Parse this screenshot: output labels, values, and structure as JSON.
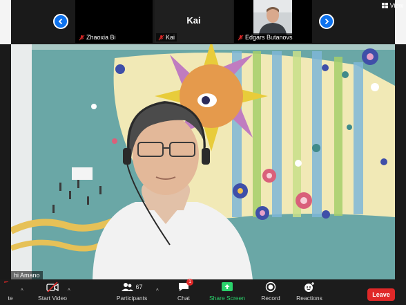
{
  "gallery": {
    "tiles": [
      {
        "name": "Zhaoxia Bi"
      },
      {
        "name": "Kai",
        "big_name": "Kai"
      },
      {
        "name": "Edgars Butanovs"
      }
    ],
    "view_label": "View"
  },
  "main": {
    "speaker_name": "hi Amano"
  },
  "toolbar": {
    "mute_label": "te",
    "video_label": "Start Video",
    "participants_label": "Participants",
    "participants_count": "67",
    "chat_label": "Chat",
    "chat_badge": "1",
    "share_label": "Share Screen",
    "record_label": "Record",
    "reactions_label": "Reactions",
    "leave_label": "Leave"
  },
  "colors": {
    "accent_blue": "#0e72ed",
    "share_green": "#2ad36c",
    "leave_red": "#e02828"
  }
}
